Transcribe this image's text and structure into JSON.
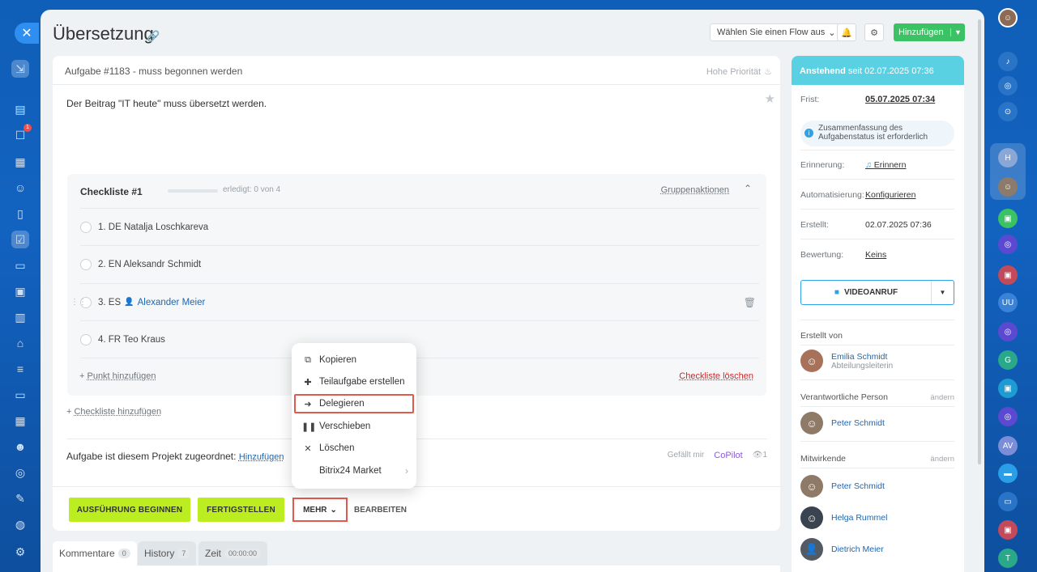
{
  "header": {
    "title": "Übersetzung",
    "flow_select": "Wählen Sie einen Flow aus",
    "add_button": "Hinzufügen"
  },
  "task": {
    "number_status": "Aufgabe #1183 - muss begonnen werden",
    "priority": "Hohe Priorität",
    "description": "Der Beitrag \"IT heute\" muss übersetzt werden."
  },
  "checklist": {
    "title": "Checkliste #1",
    "progress": "erledigt: 0 von 4",
    "group_actions": "Gruppenaktionen",
    "items": [
      {
        "text": "1. DE Natalja Loschkareva"
      },
      {
        "text": "2. EN Aleksandr Schmidt"
      },
      {
        "text": "3. ES",
        "user": "Alexander Meier"
      },
      {
        "text": "4. FR Teo Kraus"
      }
    ],
    "add_item": "Punkt hinzufügen",
    "delete": "Checkliste löschen",
    "add_checklist": "Checkliste hinzufügen"
  },
  "project": {
    "label": "Aufgabe ist diesem Projekt zugeordnet:",
    "link": "Hinzufügen",
    "likes": "Gefällt mir",
    "copilot": "CoPilot",
    "views": "1"
  },
  "footer": {
    "start": "AUSFÜHRUNG BEGINNEN",
    "finish": "FERTIGSTELLEN",
    "more": "MEHR",
    "edit": "BEARBEITEN"
  },
  "menu": {
    "items": [
      {
        "label": "Kopieren",
        "icon": "copy-icon"
      },
      {
        "label": "Teilaufgabe erstellen",
        "icon": "plus-icon"
      },
      {
        "label": "Delegieren",
        "icon": "delegate-icon"
      },
      {
        "label": "Verschieben",
        "icon": "pause-icon"
      },
      {
        "label": "Löschen",
        "icon": "close-icon"
      },
      {
        "label": "Bitrix24 Market",
        "icon": "chevron-right-icon"
      }
    ]
  },
  "tabs": [
    {
      "label": "Kommentare",
      "count": "0"
    },
    {
      "label": "History",
      "count": "7"
    },
    {
      "label": "Zeit",
      "count": "00:00:00"
    }
  ],
  "sidebar": {
    "status": "Anstehend",
    "status_since": "seit 02.07.2025 07:36",
    "deadline_label": "Frist:",
    "deadline": "05.07.2025 07:34",
    "summary_note": "Zusammenfassung des Aufgabenstatus ist erforderlich",
    "reminder_label": "Erinnerung:",
    "reminder": "Erinnern",
    "automation_label": "Automatisierung:",
    "automation": "Konfigurieren",
    "created_label": "Erstellt:",
    "created": "02.07.2025 07:36",
    "rating_label": "Bewertung:",
    "rating": "Keins",
    "video_call": "VIDEOANRUF",
    "created_by_label": "Erstellt von",
    "creator_name": "Emilia Schmidt",
    "creator_role": "Abteilungsleiterin",
    "responsible_label": "Verantwortliche Person",
    "responsible_name": "Peter Schmidt",
    "participants_label": "Mitwirkende",
    "change": "ändern",
    "participants": [
      "Peter Schmidt",
      "Helga Rummel",
      "Dietrich Meier"
    ]
  },
  "colors": {
    "accent_green": "#bbed21",
    "add_green": "#3bc264",
    "status_cyan": "#5ad1e3",
    "highlight_red": "#e05a4e",
    "link_blue": "#2067b0"
  }
}
